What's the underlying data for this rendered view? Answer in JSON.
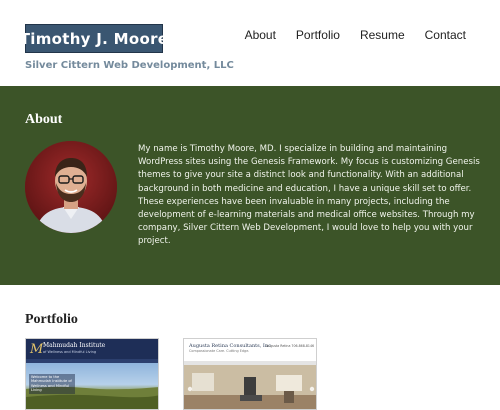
{
  "site": {
    "logo_title": "Timothy J. Moore",
    "logo_subtitle": "Silver Cittern Web Development, LLC"
  },
  "nav": {
    "items": [
      {
        "label": "About"
      },
      {
        "label": "Portfolio"
      },
      {
        "label": "Resume"
      },
      {
        "label": "Contact"
      }
    ]
  },
  "about": {
    "title": "About",
    "text": "My name is Timothy Moore, MD. I specialize in building and maintaining WordPress sites using the Genesis Framework. My focus is customizing Genesis themes to give your site a distinct look and functionality. With an additional background in both medicine and education, I have a unique skill set to offer. These experiences have been invaluable in many projects, including the development of e-learning materials and medical office websites. Through my company, Silver Cittern Web Development, I would love to help you with your project."
  },
  "portfolio": {
    "title": "Portfolio",
    "items": [
      {
        "name": "Mahmudah Institute",
        "tagline": "of Wellness and Mindful Living",
        "caption": "Welcome to the Mahmudah Institute of Wellness and Mindful Living"
      },
      {
        "name": "Augusta Retina Consultants, Inc",
        "tagline": "Compassionate Care. Cutting Edge.",
        "contact": "Augusta Retina\n706-868-8146"
      }
    ]
  },
  "colors": {
    "logo_bg": "#3a5671",
    "logo_subtitle": "#748a9c",
    "about_bg": "#3c5428",
    "about_text": "#f1f4ec"
  }
}
